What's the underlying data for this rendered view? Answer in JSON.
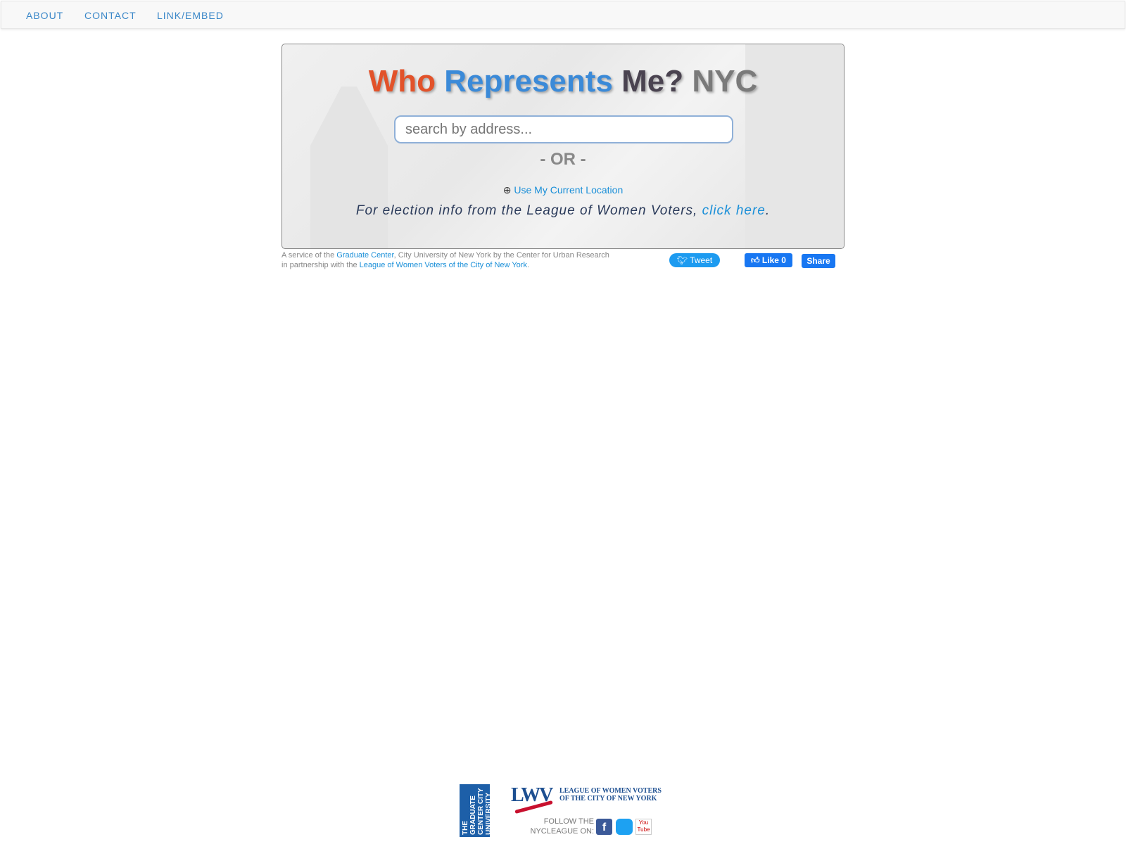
{
  "nav": {
    "items": [
      "ABOUT",
      "CONTACT",
      "LINK/EMBED"
    ]
  },
  "hero": {
    "title": {
      "who": "Who",
      "represents": "Represents",
      "me": "Me?",
      "nyc": "NYC"
    },
    "colors": {
      "who": "#e2522a",
      "represents": "#3b8ad8",
      "me": "#4a4350",
      "nyc": "#7a7a7a"
    },
    "search_placeholder": "search by address...",
    "or": "- OR -",
    "location_label": "Use My Current Location",
    "lwv_text": "For election info from the League of Women Voters, ",
    "lwv_link": "click here",
    "lwv_end": "."
  },
  "credit": {
    "t1": "A service of the ",
    "l1": "Graduate Center",
    "t2": ", City University of New York by the Center for Urban Research in partnership with the ",
    "l2": "League of Women Voters of the City of New York",
    "t3": "."
  },
  "social": {
    "tweet": "Tweet",
    "like": "Like 0",
    "share": "Share"
  },
  "footer": {
    "gc_logo": "THE GRADUATE CENTER CITY UNIVERSITY OF NEW YORK",
    "lwv_logo": "LWV",
    "lwv_name1": "LEAGUE OF WOMEN VOTERS",
    "lwv_name2": "OF THE CITY OF NEW YORK",
    "follow1": "FOLLOW THE",
    "follow2": "NYCLEAGUE ON:"
  }
}
